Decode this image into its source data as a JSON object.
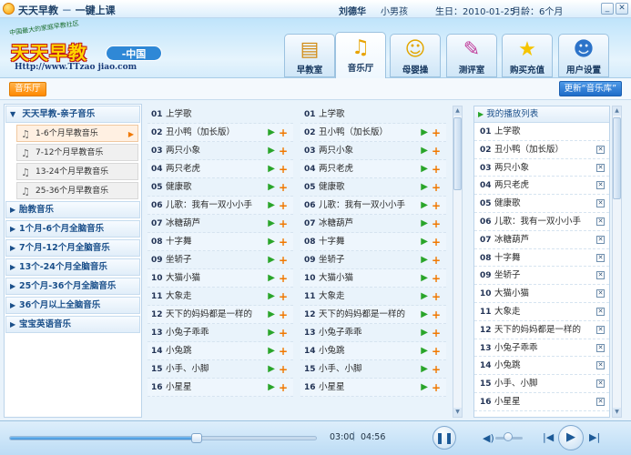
{
  "titlebar": {
    "app_name": "天天早教",
    "separator": "－",
    "slogan": "一键上课",
    "user_name": "刘德华",
    "child_gender": "小男孩",
    "birthday": "生日：2010-01-25",
    "age": "月龄：6个月"
  },
  "logo": {
    "curve_text": "中国最大的家庭早教社区",
    "brand": "天天早教",
    "region": "-中国",
    "url": "Http://www.TTzao jiao.com"
  },
  "nav_tabs": [
    {
      "label": "早教室",
      "icon": "blackboard-icon",
      "glyph": "▤",
      "color": "#d28b14"
    },
    {
      "label": "音乐厅",
      "icon": "music-notes-icon",
      "glyph": "♫",
      "color": "#e8a300"
    },
    {
      "label": "母婴操",
      "icon": "baby-exercise-icon",
      "glyph": "☺",
      "color": "#e2a600"
    },
    {
      "label": "测评室",
      "icon": "rocket-test-icon",
      "glyph": "✎",
      "color": "#c03c9a"
    },
    {
      "label": "购买充值",
      "icon": "star-icon",
      "glyph": "★",
      "color": "#f5c400"
    },
    {
      "label": "用户设置",
      "icon": "user-settings-icon",
      "glyph": "☻",
      "color": "#2c73c9"
    }
  ],
  "toolbar": {
    "hall_label": "音乐厅",
    "update_label": "更新“音乐库”"
  },
  "sidebar": {
    "top_category": "天天早教-亲子音乐",
    "subitems": [
      "1-6个月早教音乐",
      "7-12个月早教音乐",
      "13-24个月早教音乐",
      "25-36个月早教音乐"
    ],
    "categories": [
      "胎教音乐",
      "1个月-6个月全脑音乐",
      "7个月-12个月全脑音乐",
      "13个-24个月全脑音乐",
      "25个月-36个月全脑音乐",
      "36个月以上全脑音乐",
      "宝宝英语音乐"
    ]
  },
  "song_list_left": [
    {
      "num": "01",
      "title": "上学歌",
      "actions": false
    },
    {
      "num": "02",
      "title": "丑小鸭（加长版）",
      "actions": true
    },
    {
      "num": "03",
      "title": "两只小象",
      "actions": true
    },
    {
      "num": "04",
      "title": "两只老虎",
      "actions": true
    },
    {
      "num": "05",
      "title": "健康歌",
      "actions": true
    },
    {
      "num": "06",
      "title": "儿歌：我有一双小小手",
      "actions": true
    },
    {
      "num": "07",
      "title": "冰糖葫芦",
      "actions": true
    },
    {
      "num": "08",
      "title": "十字舞",
      "actions": true
    },
    {
      "num": "09",
      "title": "坐轿子",
      "actions": true
    },
    {
      "num": "10",
      "title": "大猫小猫",
      "actions": true
    },
    {
      "num": "11",
      "title": "大象走",
      "actions": true
    },
    {
      "num": "12",
      "title": "天下的妈妈都是一样的",
      "actions": true
    },
    {
      "num": "13",
      "title": "小兔子乖乖",
      "actions": true
    },
    {
      "num": "14",
      "title": "小兔跳",
      "actions": true
    },
    {
      "num": "15",
      "title": "小手、小脚",
      "actions": true
    },
    {
      "num": "16",
      "title": "小星星",
      "actions": true
    }
  ],
  "song_list_mid": [
    {
      "num": "01",
      "title": "上学歌",
      "actions": false
    },
    {
      "num": "02",
      "title": "丑小鸭（加长版）",
      "actions": true
    },
    {
      "num": "03",
      "title": "两只小象",
      "actions": true
    },
    {
      "num": "04",
      "title": "两只老虎",
      "actions": true
    },
    {
      "num": "05",
      "title": "健康歌",
      "actions": true
    },
    {
      "num": "06",
      "title": "儿歌：我有一双小小手",
      "actions": true
    },
    {
      "num": "07",
      "title": "冰糖葫芦",
      "actions": true
    },
    {
      "num": "08",
      "title": "十字舞",
      "actions": true
    },
    {
      "num": "09",
      "title": "坐轿子",
      "actions": true
    },
    {
      "num": "10",
      "title": "大猫小猫",
      "actions": true
    },
    {
      "num": "11",
      "title": "大象走",
      "actions": true
    },
    {
      "num": "12",
      "title": "天下的妈妈都是一样的",
      "actions": true
    },
    {
      "num": "13",
      "title": "小兔子乖乖",
      "actions": true
    },
    {
      "num": "14",
      "title": "小兔跳",
      "actions": true
    },
    {
      "num": "15",
      "title": "小手、小脚",
      "actions": true
    },
    {
      "num": "16",
      "title": "小星星",
      "actions": true
    }
  ],
  "playlist": {
    "title": "我的播放列表",
    "items": [
      {
        "num": "01",
        "title": "上学歌",
        "removable": false
      },
      {
        "num": "02",
        "title": "丑小鸭（加长版）",
        "removable": true
      },
      {
        "num": "03",
        "title": "两只小象",
        "removable": true
      },
      {
        "num": "04",
        "title": "两只老虎",
        "removable": true
      },
      {
        "num": "05",
        "title": "健康歌",
        "removable": true
      },
      {
        "num": "06",
        "title": "儿歌：我有一双小小手",
        "removable": true
      },
      {
        "num": "07",
        "title": "冰糖葫芦",
        "removable": true
      },
      {
        "num": "08",
        "title": "十字舞",
        "removable": true
      },
      {
        "num": "09",
        "title": "坐轿子",
        "removable": true
      },
      {
        "num": "10",
        "title": "大猫小猫",
        "removable": true
      },
      {
        "num": "11",
        "title": "大象走",
        "removable": true
      },
      {
        "num": "12",
        "title": "天下的妈妈都是一样的",
        "removable": true
      },
      {
        "num": "13",
        "title": "小兔子乖乖",
        "removable": true
      },
      {
        "num": "14",
        "title": "小兔跳",
        "removable": true
      },
      {
        "num": "15",
        "title": "小手、小脚",
        "removable": true
      },
      {
        "num": "16",
        "title": "小星星",
        "removable": true
      }
    ]
  },
  "player": {
    "current_time": "03:00",
    "separator": "|",
    "total_time": "04:56",
    "progress_fraction": 0.61,
    "volume_fraction": 0.45
  },
  "colors": {
    "play_green": "#2aa52a",
    "add_orange": "#f07800",
    "accent_blue": "#1f6cc8"
  }
}
